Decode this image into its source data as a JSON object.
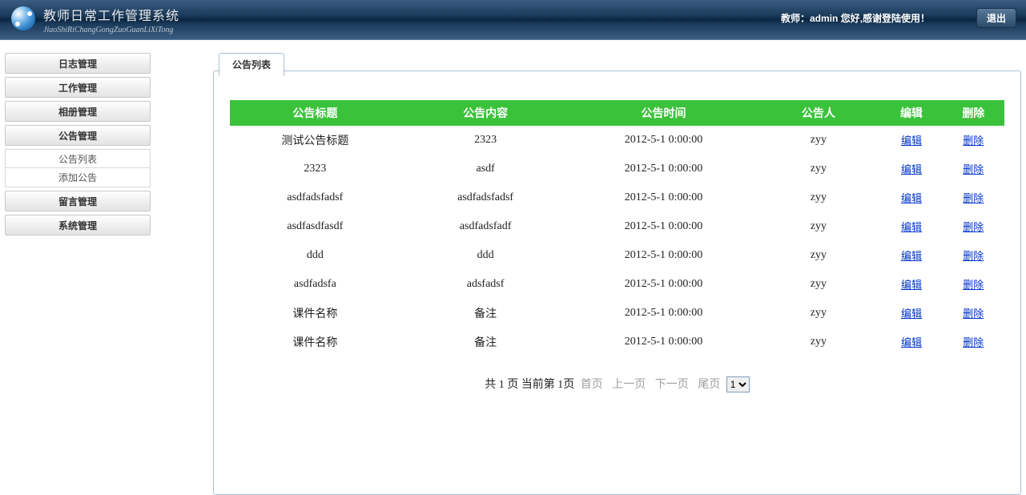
{
  "header": {
    "title": "教师日常工作管理系统",
    "subtitle": "JiaoShiRiChangGongZuoGuanLiXiTong",
    "welcome_prefix": "教师：",
    "welcome_user": "admin",
    "welcome_suffix": "您好,感谢登陆使用！",
    "logout_label": "退出"
  },
  "sidebar": {
    "items": [
      {
        "label": "日志管理",
        "sub": []
      },
      {
        "label": "工作管理",
        "sub": []
      },
      {
        "label": "相册管理",
        "sub": []
      },
      {
        "label": "公告管理",
        "sub": [
          "公告列表",
          "添加公告"
        ]
      },
      {
        "label": "留言管理",
        "sub": []
      },
      {
        "label": "系统管理",
        "sub": []
      }
    ]
  },
  "main": {
    "tab_label": "公告列表",
    "columns": [
      "公告标题",
      "公告内容",
      "公告时间",
      "公告人",
      "编辑",
      "删除"
    ],
    "edit_label": "编辑",
    "delete_label": "删除",
    "rows": [
      {
        "title": "测试公告标题",
        "content": "2323",
        "time": "2012-5-1 0:00:00",
        "author": "zyy"
      },
      {
        "title": "2323",
        "content": "asdf",
        "time": "2012-5-1 0:00:00",
        "author": "zyy"
      },
      {
        "title": "asdfadsfadsf",
        "content": "asdfadsfadsf",
        "time": "2012-5-1 0:00:00",
        "author": "zyy"
      },
      {
        "title": "asdfasdfasdf",
        "content": "asdfadsfadf",
        "time": "2012-5-1 0:00:00",
        "author": "zyy"
      },
      {
        "title": "ddd",
        "content": "ddd",
        "time": "2012-5-1 0:00:00",
        "author": "zyy"
      },
      {
        "title": "asdfadsfa",
        "content": "adsfadsf",
        "time": "2012-5-1 0:00:00",
        "author": "zyy"
      },
      {
        "title": "课件名称",
        "content": "备注",
        "time": "2012-5-1 0:00:00",
        "author": "zyy"
      },
      {
        "title": "课件名称",
        "content": "备注",
        "time": "2012-5-1 0:00:00",
        "author": "zyy"
      }
    ],
    "pager": {
      "total_text": "共 1 页 当前第 1页",
      "first": "首页",
      "prev": "上一页",
      "next": "下一页",
      "last": "尾页",
      "options": [
        "1"
      ],
      "selected": "1"
    }
  }
}
